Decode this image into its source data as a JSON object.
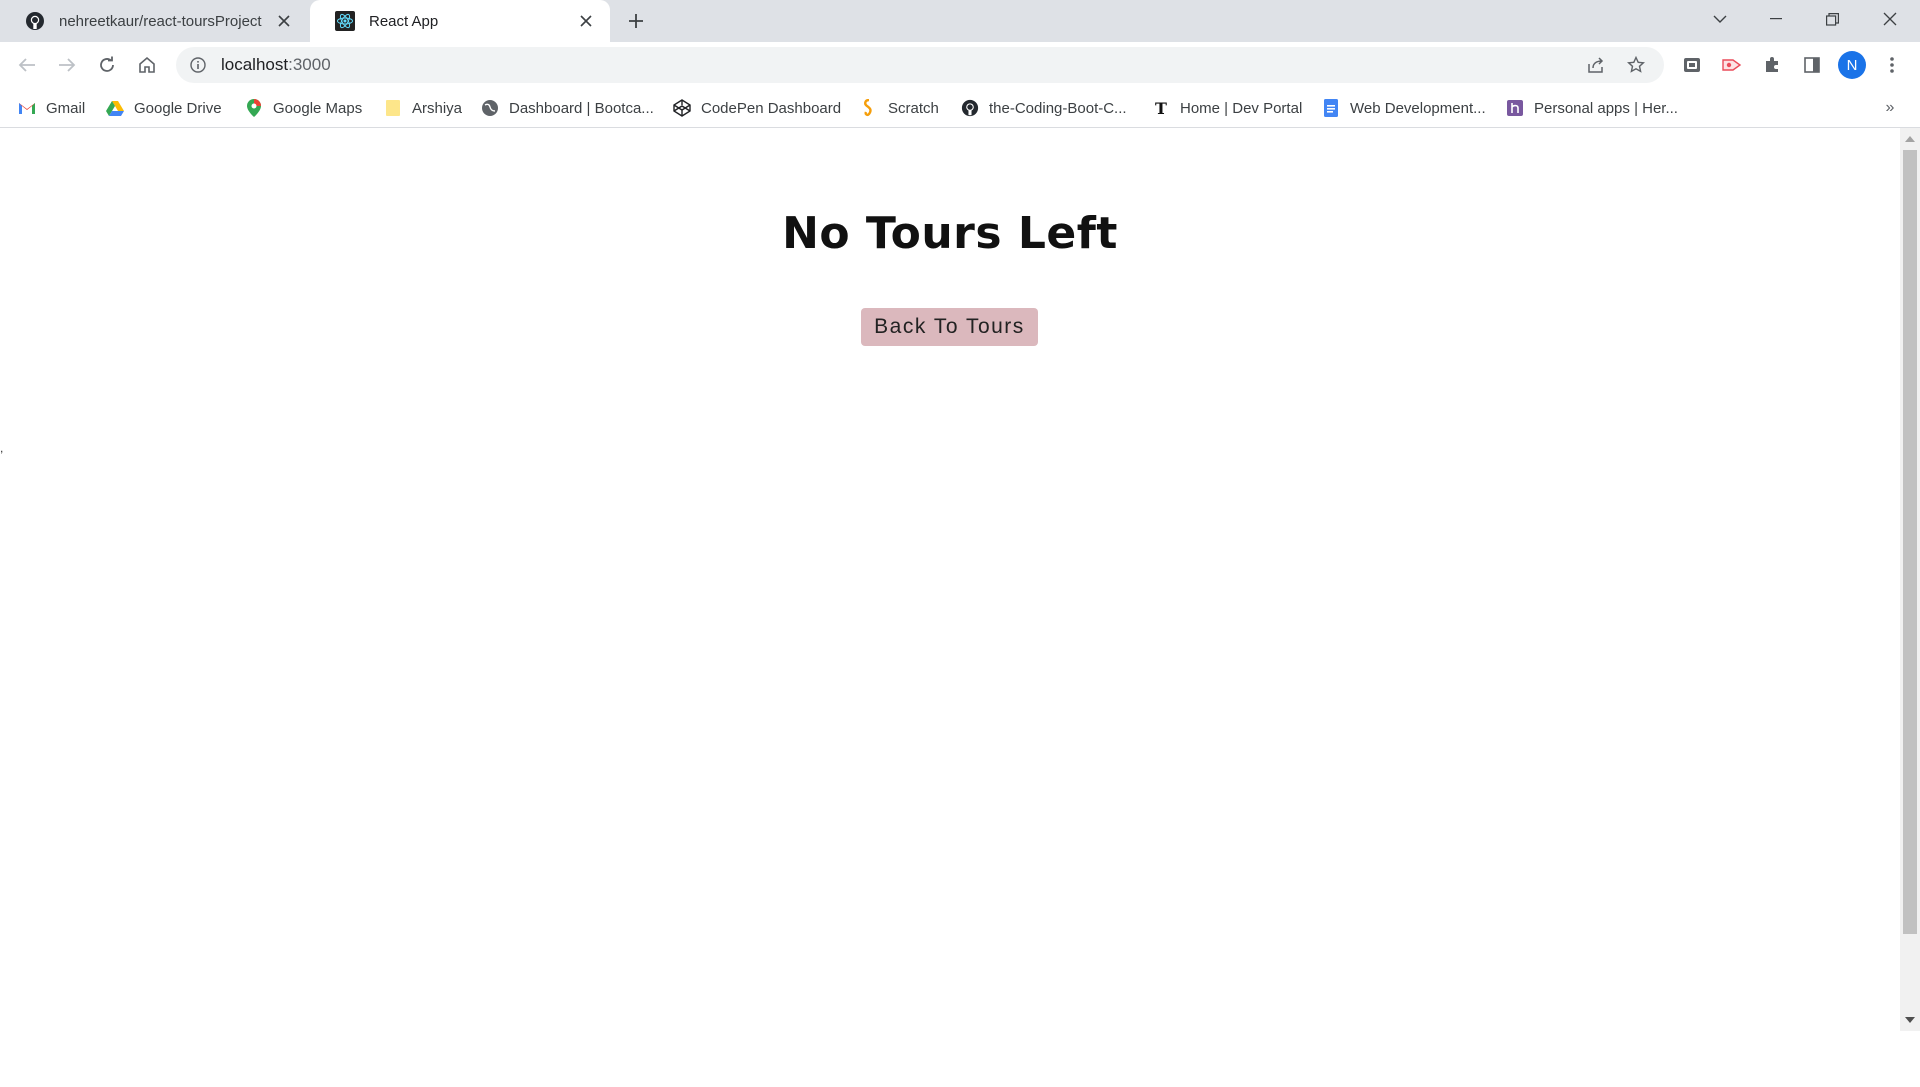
{
  "browser": {
    "tabs": [
      {
        "title": "nehreetkaur/react-toursProject",
        "active": false,
        "icon": "github-icon"
      },
      {
        "title": "React App",
        "active": true,
        "icon": "react-icon"
      }
    ],
    "address": {
      "host": "localhost",
      "port": ":3000"
    },
    "profile_initial": "N",
    "bookmarks": [
      {
        "label": "Gmail",
        "icon": "gmail-icon"
      },
      {
        "label": "Google Drive",
        "icon": "google-drive-icon"
      },
      {
        "label": "Google Maps",
        "icon": "google-maps-icon"
      },
      {
        "label": "Arshiya",
        "icon": "folder-icon"
      },
      {
        "label": "Dashboard | Bootca...",
        "icon": "globe-icon"
      },
      {
        "label": "CodePen Dashboard",
        "icon": "codepen-icon"
      },
      {
        "label": "Scratch",
        "icon": "scratch-icon"
      },
      {
        "label": "the-Coding-Boot-C...",
        "icon": "github-icon"
      },
      {
        "label": "Home | Dev Portal",
        "icon": "nyt-icon"
      },
      {
        "label": "Web Development...",
        "icon": "docs-icon"
      },
      {
        "label": "Personal apps | Her...",
        "icon": "heroku-icon"
      }
    ],
    "bookmarks_more": "»"
  },
  "page": {
    "title": "No Tours Left",
    "button_label": "Back To Tours",
    "stray_text": ","
  },
  "colors": {
    "tabstrip": "#dee1e6",
    "omnibox": "#f1f3f4",
    "button_bg": "#dbb8bd",
    "avatar": "#1a73e8"
  }
}
